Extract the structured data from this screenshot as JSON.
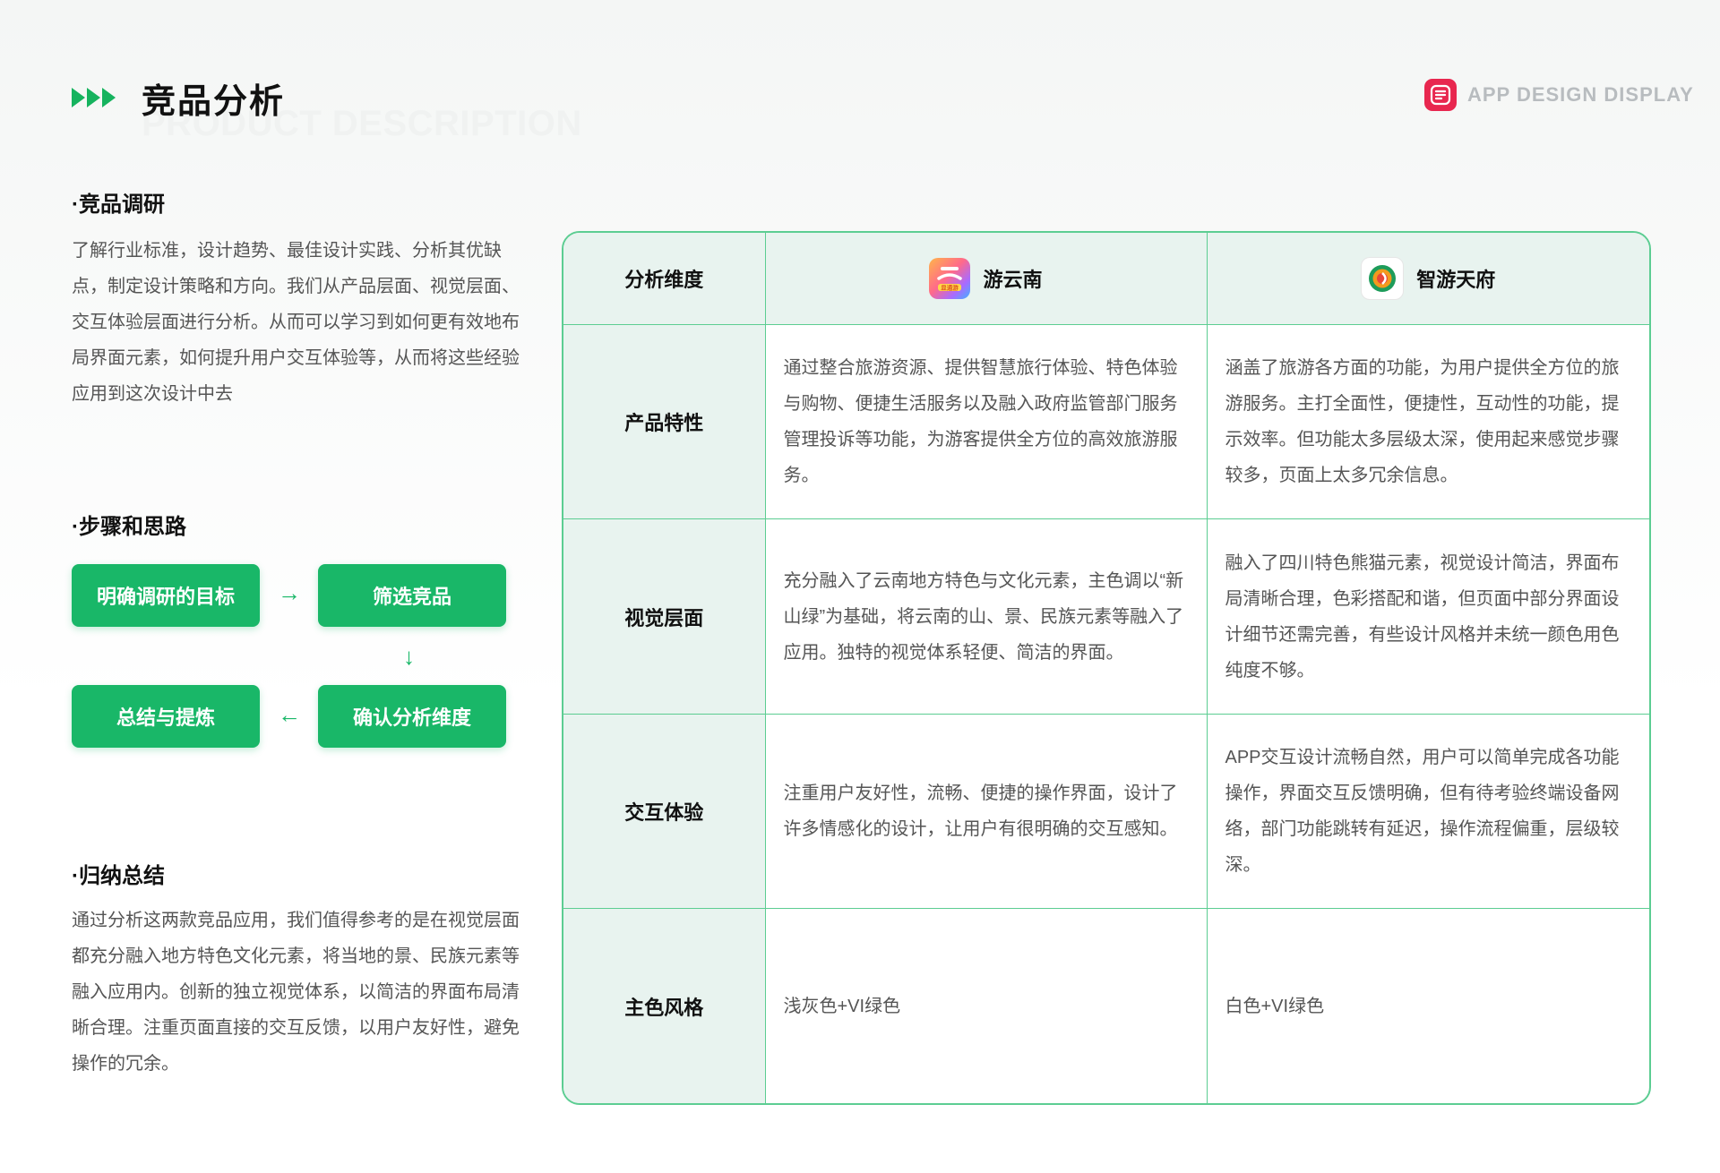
{
  "header": {
    "title": "竞品分析",
    "subtitle": "PRODUCT DESCRIPTION",
    "brand": "APP DESIGN DISPLAY"
  },
  "research": {
    "title": "·竞品调研",
    "text": "了解行业标准，设计趋势、最佳设计实践、分析其优缺点，制定设计策略和方向。我们从产品层面、视觉层面、交互体验层面进行分析。从而可以学习到如何更有效地布局界面元素，如何提升用户交互体验等，从而将这些经验应用到这次设计中去"
  },
  "steps": {
    "title": "·步骤和思路",
    "items": [
      "明确调研的目标",
      "筛选竞品",
      "确认分析维度",
      "总结与提炼"
    ]
  },
  "summary": {
    "title": "·归纳总结",
    "text": "通过分析这两款竞品应用，我们值得参考的是在视觉层面都充分融入地方特色文化元素，将当地的景、民族元素等融入应用内。创新的独立视觉体系，以简洁的界面布局清晰合理。注重页面直接的交互反馈，以用户友好性，避免操作的冗余。"
  },
  "table": {
    "dimension_header": "分析维度",
    "app1": {
      "name": "游云南",
      "icon": "youyunnan-app-icon",
      "icon_text": "显通游"
    },
    "app2": {
      "name": "智游天府",
      "icon": "zhiyoutianfu-app-icon"
    },
    "rows": [
      {
        "dimension": "产品特性",
        "app1": "通过整合旅游资源、提供智慧旅行体验、特色体验与购物、便捷生活服务以及融入政府监管部门服务管理投诉等功能，为游客提供全方位的高效旅游服务。",
        "app2": "涵盖了旅游各方面的功能，为用户提供全方位的旅游服务。主打全面性，便捷性，互动性的功能，提示效率。但功能太多层级太深，使用起来感觉步骤较多，页面上太多冗余信息。"
      },
      {
        "dimension": "视觉层面",
        "app1": "充分融入了云南地方特色与文化元素，主色调以“新山绿”为基础，将云南的山、景、民族元素等融入了应用。独特的视觉体系轻便、简洁的界面。",
        "app2": "融入了四川特色熊猫元素，视觉设计简洁，界面布局清晰合理，色彩搭配和谐，但页面中部分界面设计细节还需完善，有些设计风格并未统一颜色用色纯度不够。"
      },
      {
        "dimension": "交互体验",
        "app1": "注重用户友好性，流畅、便捷的操作界面，设计了许多情感化的设计，让用户有很明确的交互感知。",
        "app2": "APP交互设计流畅自然，用户可以简单完成各功能操作，界面交互反馈明确，但有待考验终端设备网络，部门功能跳转有延迟，操作流程偏重，层级较深。"
      },
      {
        "dimension": "主色风格",
        "app1": "浅灰色+VI绿色",
        "app2": "白色+VI绿色"
      }
    ]
  },
  "colors": {
    "accent": "#19b768",
    "table_border": "#5ccd92",
    "header_bg": "#e8f3ef",
    "brand": "#e8274f"
  }
}
